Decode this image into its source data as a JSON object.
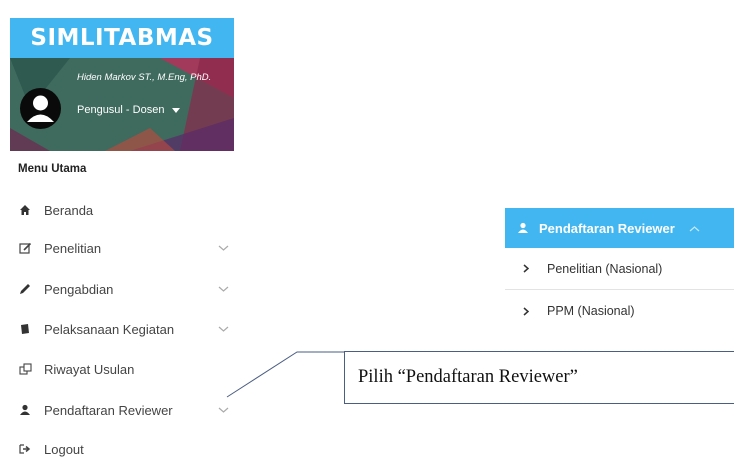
{
  "app": {
    "brand": "SIMLITABMAS"
  },
  "user": {
    "name": "Hiden Markov ST., M.Eng, PhD.",
    "role": "Pengusul - Dosen"
  },
  "menu": {
    "title": "Menu Utama",
    "items": [
      {
        "label": "Beranda",
        "icon": "home-icon",
        "expandable": false
      },
      {
        "label": "Penelitian",
        "icon": "edit-icon",
        "expandable": true
      },
      {
        "label": "Pengabdian",
        "icon": "pencil-icon",
        "expandable": true
      },
      {
        "label": "Pelaksanaan Kegiatan",
        "icon": "book-icon",
        "expandable": true
      },
      {
        "label": "Riwayat Usulan",
        "icon": "history-icon",
        "expandable": false
      },
      {
        "label": "Pendaftaran Reviewer",
        "icon": "user-icon",
        "expandable": true
      },
      {
        "label": "Logout",
        "icon": "logout-icon",
        "expandable": false
      }
    ]
  },
  "dropdown": {
    "header": "Pendaftaran Reviewer",
    "items": [
      {
        "label": "Penelitian (Nasional)"
      },
      {
        "label": "PPM (Nasional)"
      }
    ]
  },
  "callout": {
    "text": "Pilih “Pendaftaran Reviewer”"
  },
  "colors": {
    "accent": "#41b6f0",
    "profile_bg": "#3f6a5e",
    "callout_border": "#4a5d83"
  }
}
